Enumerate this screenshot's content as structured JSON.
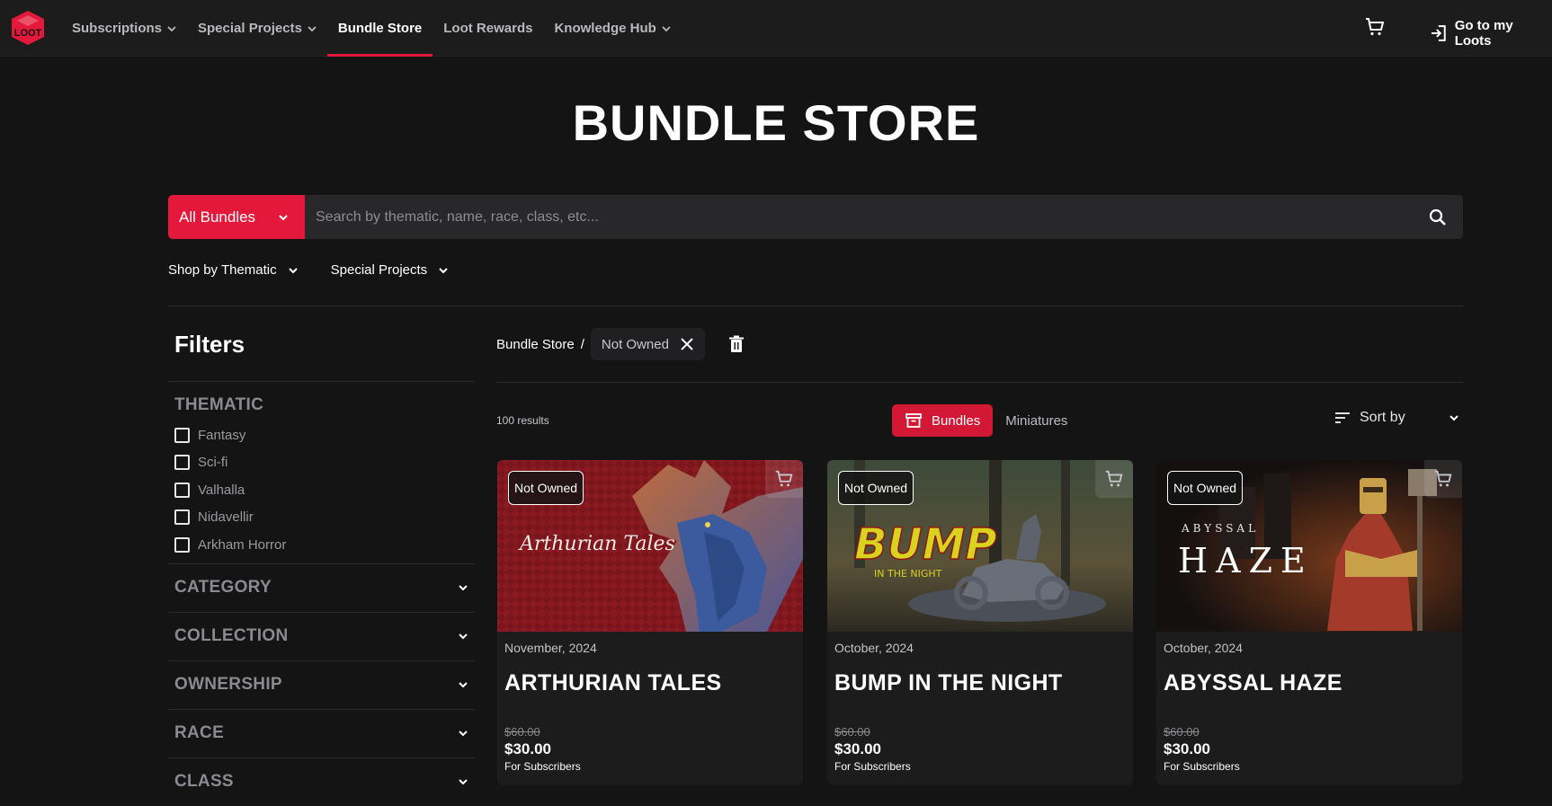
{
  "nav": {
    "items": [
      {
        "label": "Subscriptions",
        "dropdown": true,
        "active": false
      },
      {
        "label": "Special Projects",
        "dropdown": true,
        "active": false
      },
      {
        "label": "Bundle Store",
        "dropdown": false,
        "active": true
      },
      {
        "label": "Loot Rewards",
        "dropdown": false,
        "active": false
      },
      {
        "label": "Knowledge Hub",
        "dropdown": true,
        "active": false
      }
    ],
    "cart_icon": "cart-icon",
    "goto_label": "Go to my Loots"
  },
  "page_title": "BUNDLE STORE",
  "search": {
    "category_label": "All Bundles",
    "placeholder": "Search by thematic, name, race, class, etc..."
  },
  "subnav": {
    "thematic_label": "Shop by Thematic",
    "special_label": "Special Projects"
  },
  "filters": {
    "title": "Filters",
    "thematic": {
      "title": "THEMATIC",
      "options": [
        "Fantasy",
        "Sci-fi",
        "Valhalla",
        "Nidavellir",
        "Arkham Horror"
      ]
    },
    "sections": [
      "CATEGORY",
      "COLLECTION",
      "OWNERSHIP",
      "RACE",
      "CLASS"
    ]
  },
  "breadcrumb": {
    "root": "Bundle Store",
    "separator": "/",
    "chip": "Not Owned"
  },
  "results_count": "100 results",
  "view_toggle": {
    "active": "Bundles",
    "other": "Miniatures"
  },
  "sort_label": "Sort by",
  "cards": [
    {
      "badge": "Not Owned",
      "date": "November, 2024",
      "title": "ARTHURIAN TALES",
      "old_price": "$60.00",
      "price": "$30.00",
      "price_note": "For Subscribers"
    },
    {
      "badge": "Not Owned",
      "date": "October, 2024",
      "title": "BUMP IN THE NIGHT",
      "old_price": "$60.00",
      "price": "$30.00",
      "price_note": "For Subscribers"
    },
    {
      "badge": "Not Owned",
      "date": "October, 2024",
      "title": "ABYSSAL HAZE",
      "old_price": "$60.00",
      "price": "$30.00",
      "price_note": "For Subscribers"
    }
  ],
  "art": {
    "card1_text": "Arthurian Tales",
    "card2_text": "BUMP",
    "card2_sub": "IN THE NIGHT",
    "card3_small": "ABYSSAL",
    "card3_big": "HAZE"
  },
  "colors": {
    "accent": "#e3183b",
    "background": "#141414",
    "panel": "#1c1c1d"
  }
}
